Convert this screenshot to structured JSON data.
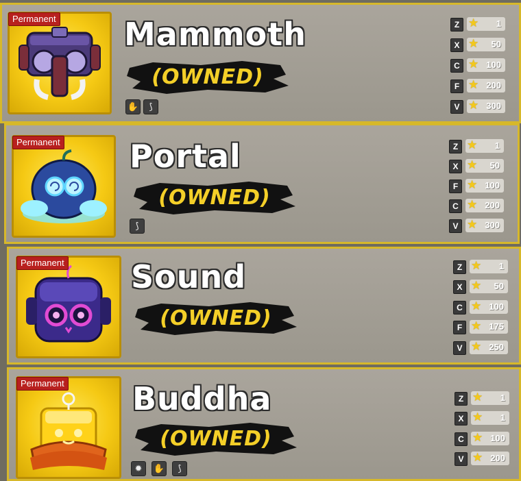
{
  "cards": [
    {
      "name": "Mammoth",
      "badge": "Permanent",
      "status": "(OWNED)",
      "abilities": [
        "claw-icon",
        "horn-icon"
      ],
      "moves": [
        {
          "key": "Z",
          "cost": "1"
        },
        {
          "key": "X",
          "cost": "50"
        },
        {
          "key": "C",
          "cost": "100"
        },
        {
          "key": "F",
          "cost": "200"
        },
        {
          "key": "V",
          "cost": "300"
        }
      ]
    },
    {
      "name": "Portal",
      "badge": "Permanent",
      "status": "(OWNED)",
      "abilities": [
        "horn-icon"
      ],
      "moves": [
        {
          "key": "Z",
          "cost": "1"
        },
        {
          "key": "X",
          "cost": "50"
        },
        {
          "key": "F",
          "cost": "100"
        },
        {
          "key": "C",
          "cost": "200"
        },
        {
          "key": "V",
          "cost": "300"
        }
      ]
    },
    {
      "name": "Sound",
      "badge": "Permanent",
      "status": "(OWNED)",
      "abilities": [],
      "moves": [
        {
          "key": "Z",
          "cost": "1"
        },
        {
          "key": "X",
          "cost": "50"
        },
        {
          "key": "C",
          "cost": "100"
        },
        {
          "key": "F",
          "cost": "175"
        },
        {
          "key": "V",
          "cost": "250"
        }
      ]
    },
    {
      "name": "Buddha",
      "badge": "Permanent",
      "status": "(OWNED)",
      "abilities": [
        "gear-icon",
        "claw-icon",
        "horn-icon"
      ],
      "moves": [
        {
          "key": "Z",
          "cost": "1"
        },
        {
          "key": "X",
          "cost": "1"
        },
        {
          "key": "C",
          "cost": "100"
        },
        {
          "key": "V",
          "cost": "200"
        }
      ]
    }
  ],
  "colors": {
    "card_border": "#d7b82a",
    "badge_red": "#b8201e",
    "owned_gold": "#f4cf28",
    "star_gold": "#f3c81c"
  }
}
